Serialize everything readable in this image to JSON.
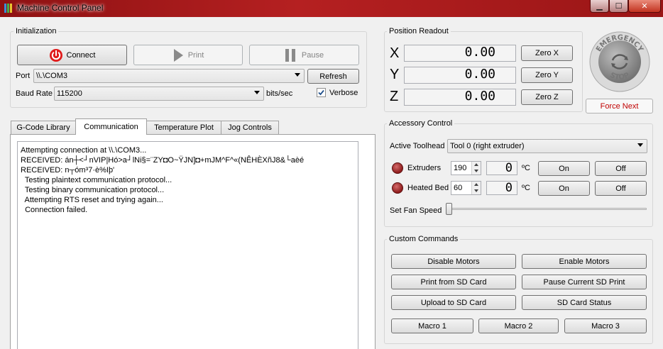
{
  "window": {
    "title": "Machine Control Panel",
    "min_glyph": "▁",
    "max_glyph": "☐",
    "close_glyph": "✕"
  },
  "initialization": {
    "title": "Initialization",
    "connect_label": "Connect",
    "print_label": "Print",
    "pause_label": "Pause",
    "port_label": "Port",
    "port_value": "\\\\.\\COM3",
    "refresh_label": "Refresh",
    "baud_label": "Baud Rate",
    "baud_value": "115200",
    "bits_label": "bits/sec",
    "verbose_label": "Verbose",
    "verbose_checked": true
  },
  "tabs": [
    {
      "label": "G-Code Library",
      "active": false
    },
    {
      "label": "Communication",
      "active": true
    },
    {
      "label": "Temperature Plot",
      "active": false
    },
    {
      "label": "Jog Controls",
      "active": false
    }
  ],
  "log": [
    "Attempting connection at \\\\.\\COM3...",
    "RECEIVED: án┼<┘nVIP|Hó>a┘lNi§=¨ZY◘O~ŸJN]◘+mJM^F^«(NÊHÈXñJ8&└aèé",
    "RECEIVED: n┬óm³7·è%Iþ'",
    "  Testing plaintext communication protocol...",
    "  Testing binary communication protocol...",
    "  Attempting RTS reset and trying again...",
    "  Connection failed."
  ],
  "position": {
    "title": "Position Readout",
    "axes": [
      {
        "axis": "X",
        "value": "0.00",
        "zero_label": "Zero X"
      },
      {
        "axis": "Y",
        "value": "0.00",
        "zero_label": "Zero Y"
      },
      {
        "axis": "Z",
        "value": "0.00",
        "zero_label": "Zero Z"
      }
    ]
  },
  "emergency": {
    "text": "EMERGENCY STOP",
    "force_next_label": "Force Next",
    "force_next_color": "#c00000",
    "button_color": "#8e8e8e"
  },
  "accessory": {
    "title": "Accessory Control",
    "toolhead_label": "Active Toolhead",
    "toolhead_value": "Tool 0 (right extruder)",
    "extruders_label": "Extruders",
    "extruders_target": "190",
    "extruders_current": "0",
    "heated_bed_label": "Heated Bed",
    "heated_bed_target": "60",
    "heated_bed_current": "0",
    "unit": "ºC",
    "on_label": "On",
    "off_label": "Off",
    "fan_label": "Set Fan Speed",
    "fan_speed": 0
  },
  "custom": {
    "title": "Custom Commands",
    "disable_motors": "Disable Motors",
    "enable_motors": "Enable Motors",
    "print_sd": "Print from SD Card",
    "pause_sd": "Pause Current SD Print",
    "upload_sd": "Upload to SD Card",
    "sd_status": "SD Card Status",
    "macro1": "Macro 1",
    "macro2": "Macro 2",
    "macro3": "Macro 3"
  },
  "colors": {
    "titlebar": "#b52021",
    "led": "#a82626",
    "force_next_text": "#c00000"
  }
}
